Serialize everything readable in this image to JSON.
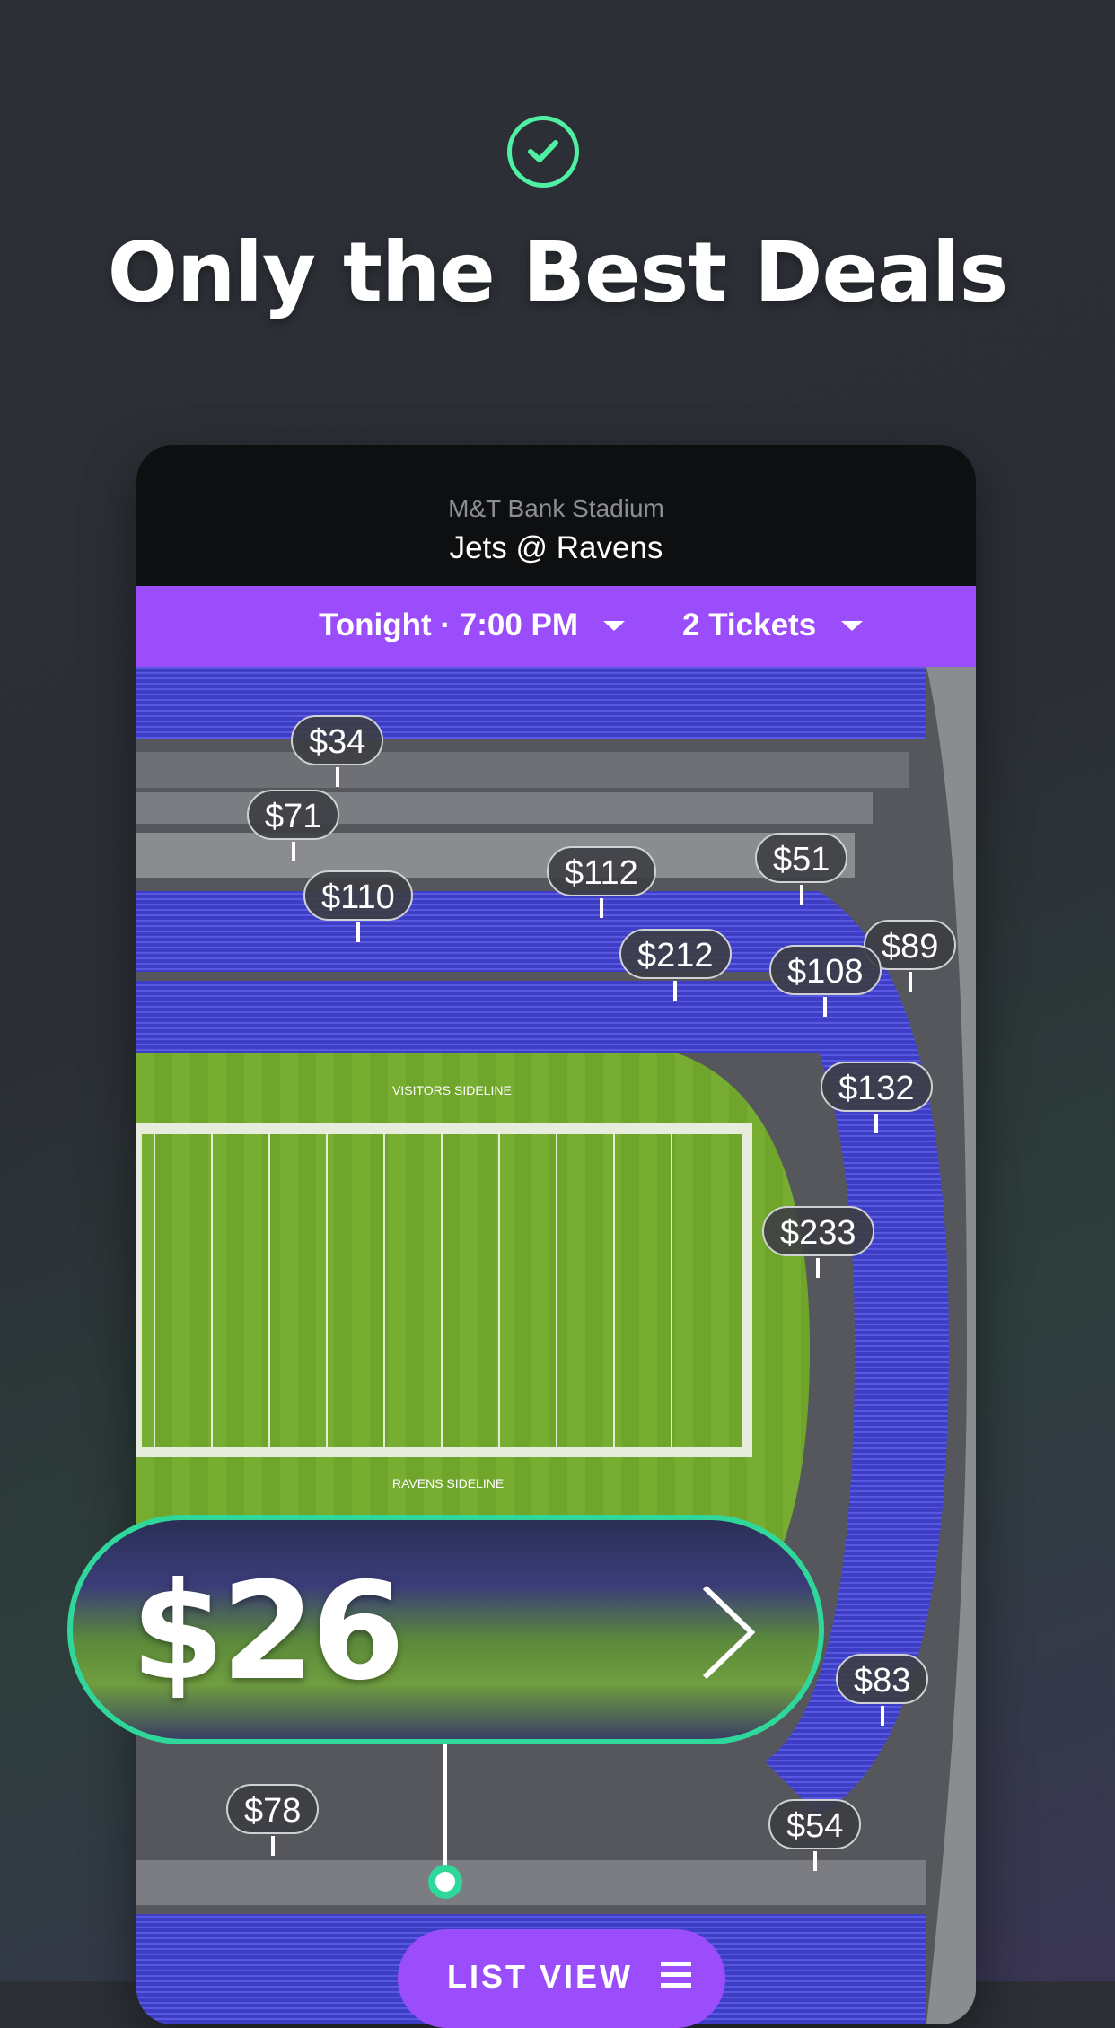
{
  "headline": "Only the Best Deals",
  "header": {
    "venue": "M&T Bank Stadium",
    "matchup": "Jets @ Ravens"
  },
  "filters": {
    "time": "Tonight · 7:00 PM",
    "tickets": "2 Tickets"
  },
  "map": {
    "sideline_top": "VISITORS SIDELINE",
    "sideline_bottom": "RAVENS SIDELINE",
    "price_pins": [
      "$34",
      "$71",
      "$110",
      "$112",
      "$51",
      "$89",
      "$212",
      "$108",
      "$132",
      "$233",
      "$83",
      "$78",
      "$54"
    ]
  },
  "featured_deal": {
    "price": "$26"
  },
  "list_view": {
    "label": "LIST VIEW"
  },
  "colors": {
    "accent_purple": "#9b4dfb",
    "success_green": "#2fd89a",
    "check_green": "#4ff0a4"
  }
}
